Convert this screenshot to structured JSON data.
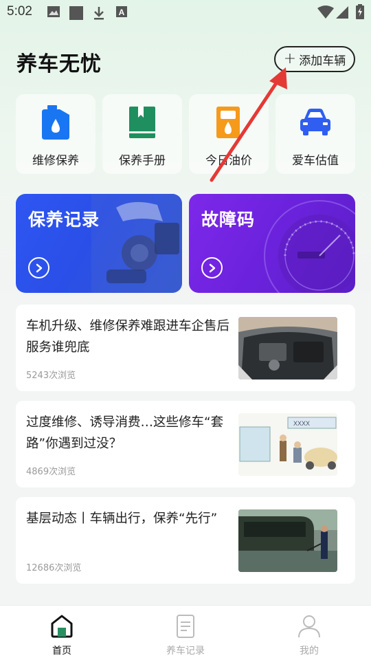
{
  "status_bar": {
    "time": "5:02"
  },
  "header": {
    "title": "养车无忧",
    "add_button_label": "添加车辆",
    "add_button_plus": "+"
  },
  "quick_actions": [
    {
      "label": "维修保养",
      "icon": "oil-can-icon"
    },
    {
      "label": "保养手册",
      "icon": "manual-book-icon"
    },
    {
      "label": "今日油价",
      "icon": "fuel-pump-icon"
    },
    {
      "label": "爱车估值",
      "icon": "car-icon"
    }
  ],
  "feature_cards": [
    {
      "title": "保养记录",
      "color": "#2f56f2"
    },
    {
      "title": "故障码",
      "color": "#7d28ea"
    }
  ],
  "news": [
    {
      "title": "车机升级、维修保养难跟进车企售后服务谁兜底",
      "views": "5243次浏览"
    },
    {
      "title": "过度维修、诱导消费…这些修车“套路”你遇到过没？",
      "views": "4869次浏览"
    },
    {
      "title": "基层动态丨车辆出行，保养“先行”",
      "views": "12686次浏览"
    }
  ],
  "tabbar": [
    {
      "label": "首页",
      "icon": "home-icon",
      "active": true
    },
    {
      "label": "养车记录",
      "icon": "document-icon",
      "active": false
    },
    {
      "label": "我的",
      "icon": "person-icon",
      "active": false
    }
  ],
  "colors": {
    "accent_red_arrow": "#e53935",
    "tile_blue": "#1976f2",
    "tile_green": "#1f8f5f",
    "tile_orange": "#f59a1b"
  }
}
